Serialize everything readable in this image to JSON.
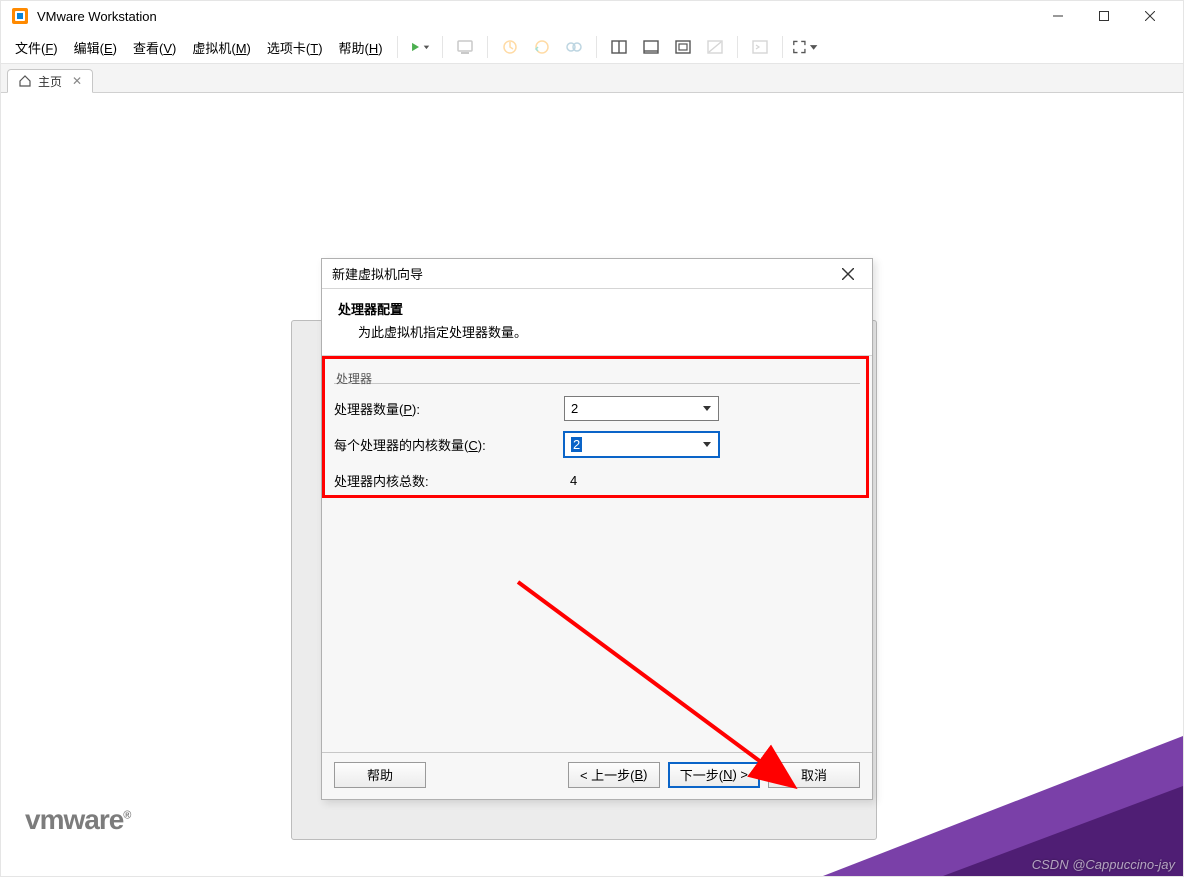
{
  "window": {
    "title": "VMware Workstation"
  },
  "menubar": {
    "file": "文件(F)",
    "edit": "编辑(E)",
    "view": "查看(V)",
    "vm": "虚拟机(M)",
    "tabs": "选项卡(T)",
    "help": "帮助(H)"
  },
  "tab": {
    "home_label": "主页"
  },
  "wizard": {
    "title": "新建虚拟机向导",
    "header_main": "处理器配置",
    "header_sub": "为此虚拟机指定处理器数量。",
    "group_label": "处理器",
    "row_processors": "处理器数量(P):",
    "row_cores": "每个处理器的内核数量(C):",
    "row_total": "处理器内核总数:",
    "processors_value": "2",
    "cores_value": "2",
    "total_value": "4",
    "buttons": {
      "help": "帮助",
      "back": "< 上一步(B)",
      "next": "下一步(N) >",
      "cancel": "取消"
    }
  },
  "branding": {
    "logo_text": "vmware",
    "watermark": "CSDN @Cappuccino-jay"
  }
}
